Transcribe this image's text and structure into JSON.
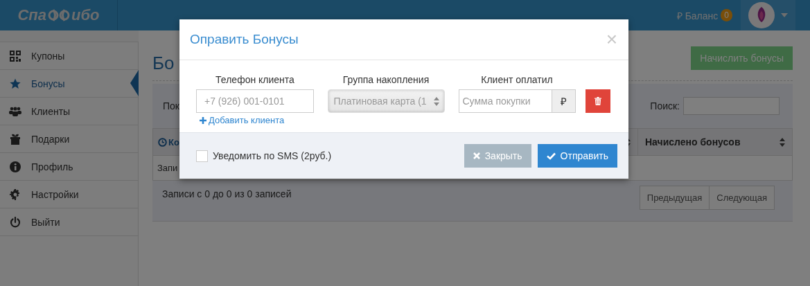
{
  "header": {
    "logo_left": "Спа",
    "logo_right": "ибо",
    "balance_currency": "₽",
    "balance_label": "Баланс",
    "balance_count": "0"
  },
  "sidebar": {
    "items": [
      {
        "label": "Купоны",
        "selected": false
      },
      {
        "label": "Бонусы",
        "selected": true
      },
      {
        "label": "Клиенты",
        "selected": false
      },
      {
        "label": "Подарки",
        "selected": false
      },
      {
        "label": "Профиль",
        "selected": false
      },
      {
        "label": "Настройки",
        "selected": false
      },
      {
        "label": "Выйти",
        "selected": false
      }
    ]
  },
  "page": {
    "title": "Бо",
    "accrue_button": "Начислить бонусы",
    "show_text": "Пок",
    "search_label": "Поиск:",
    "table": {
      "columns": [
        {
          "label": "Ко"
        },
        {
          "label": "Начислено бонусов"
        }
      ],
      "rows": [
        [
          "Запи"
        ]
      ]
    },
    "info": "Записи с 0 до 0 из 0 записей",
    "pager": [
      "Предыдущая",
      "Следующая"
    ]
  },
  "modal": {
    "title": "Оправить Бонусы",
    "close": "×",
    "phone": {
      "label": "Телефон клиента",
      "placeholder": "+7 (926) 001-0101"
    },
    "add_client": "Добавить клиента",
    "group": {
      "label": "Группа накопления",
      "value": "Платиновая карта (1"
    },
    "paid": {
      "label": "Клиент оплатил",
      "placeholder": "Сумма покупки",
      "addon": "₽"
    },
    "sms": {
      "label": "Уведомить по SMS (2руб.)",
      "checked": false
    },
    "buttons": [
      {
        "label": "Закрыть",
        "kind": "close"
      },
      {
        "label": "Отправить",
        "kind": "submit"
      }
    ]
  }
}
